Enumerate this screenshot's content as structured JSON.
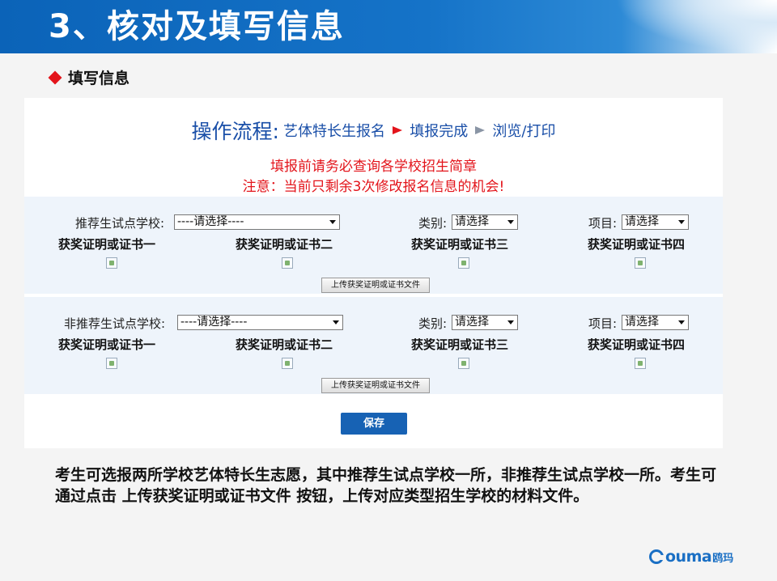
{
  "slide": {
    "title": "3、核对及填写信息",
    "section_heading": "填写信息",
    "description": "考生可选报两所学校艺体特长生志愿，其中推荐生试点学校一所，非推荐生试点学校一所。考生可通过点击 上传获奖证明或证书文件 按钮，上传对应类型招生学校的材料文件。",
    "logo_text": "ouma",
    "logo_cn": "鸥玛"
  },
  "flow": {
    "title": "操作流程:",
    "steps": [
      "艺体特长生报名",
      "填报完成",
      "浏览/打印"
    ]
  },
  "notices": {
    "line1": "填报前请务必查询各学校招生简章",
    "line2": "注意：当前只剩余3次修改报名信息的机会!"
  },
  "recommended": {
    "school_label": "推荐生试点学校:",
    "school_value": "----请选择----",
    "category_label": "类别:",
    "category_value": "请选择",
    "project_label": "项目:",
    "project_value": "请选择",
    "certificates": [
      "获奖证明或证书一",
      "获奖证明或证书二",
      "获奖证明或证书三",
      "获奖证明或证书四"
    ],
    "upload_label": "上传获奖证明或证书文件"
  },
  "non_recommended": {
    "school_label": "非推荐生试点学校:",
    "school_value": "----请选择----",
    "category_label": "类别:",
    "category_value": "请选择",
    "project_label": "项目:",
    "project_value": "请选择",
    "certificates": [
      "获奖证明或证书一",
      "获奖证明或证书二",
      "获奖证明或证书三",
      "获奖证明或证书四"
    ],
    "upload_label": "上传获奖证明或证书文件"
  },
  "save_label": "保存",
  "colors": {
    "header_blue": "#0b63b8",
    "flow_blue": "#1a4fa8",
    "notice_red": "#e3141b",
    "button_blue": "#1762b4"
  }
}
